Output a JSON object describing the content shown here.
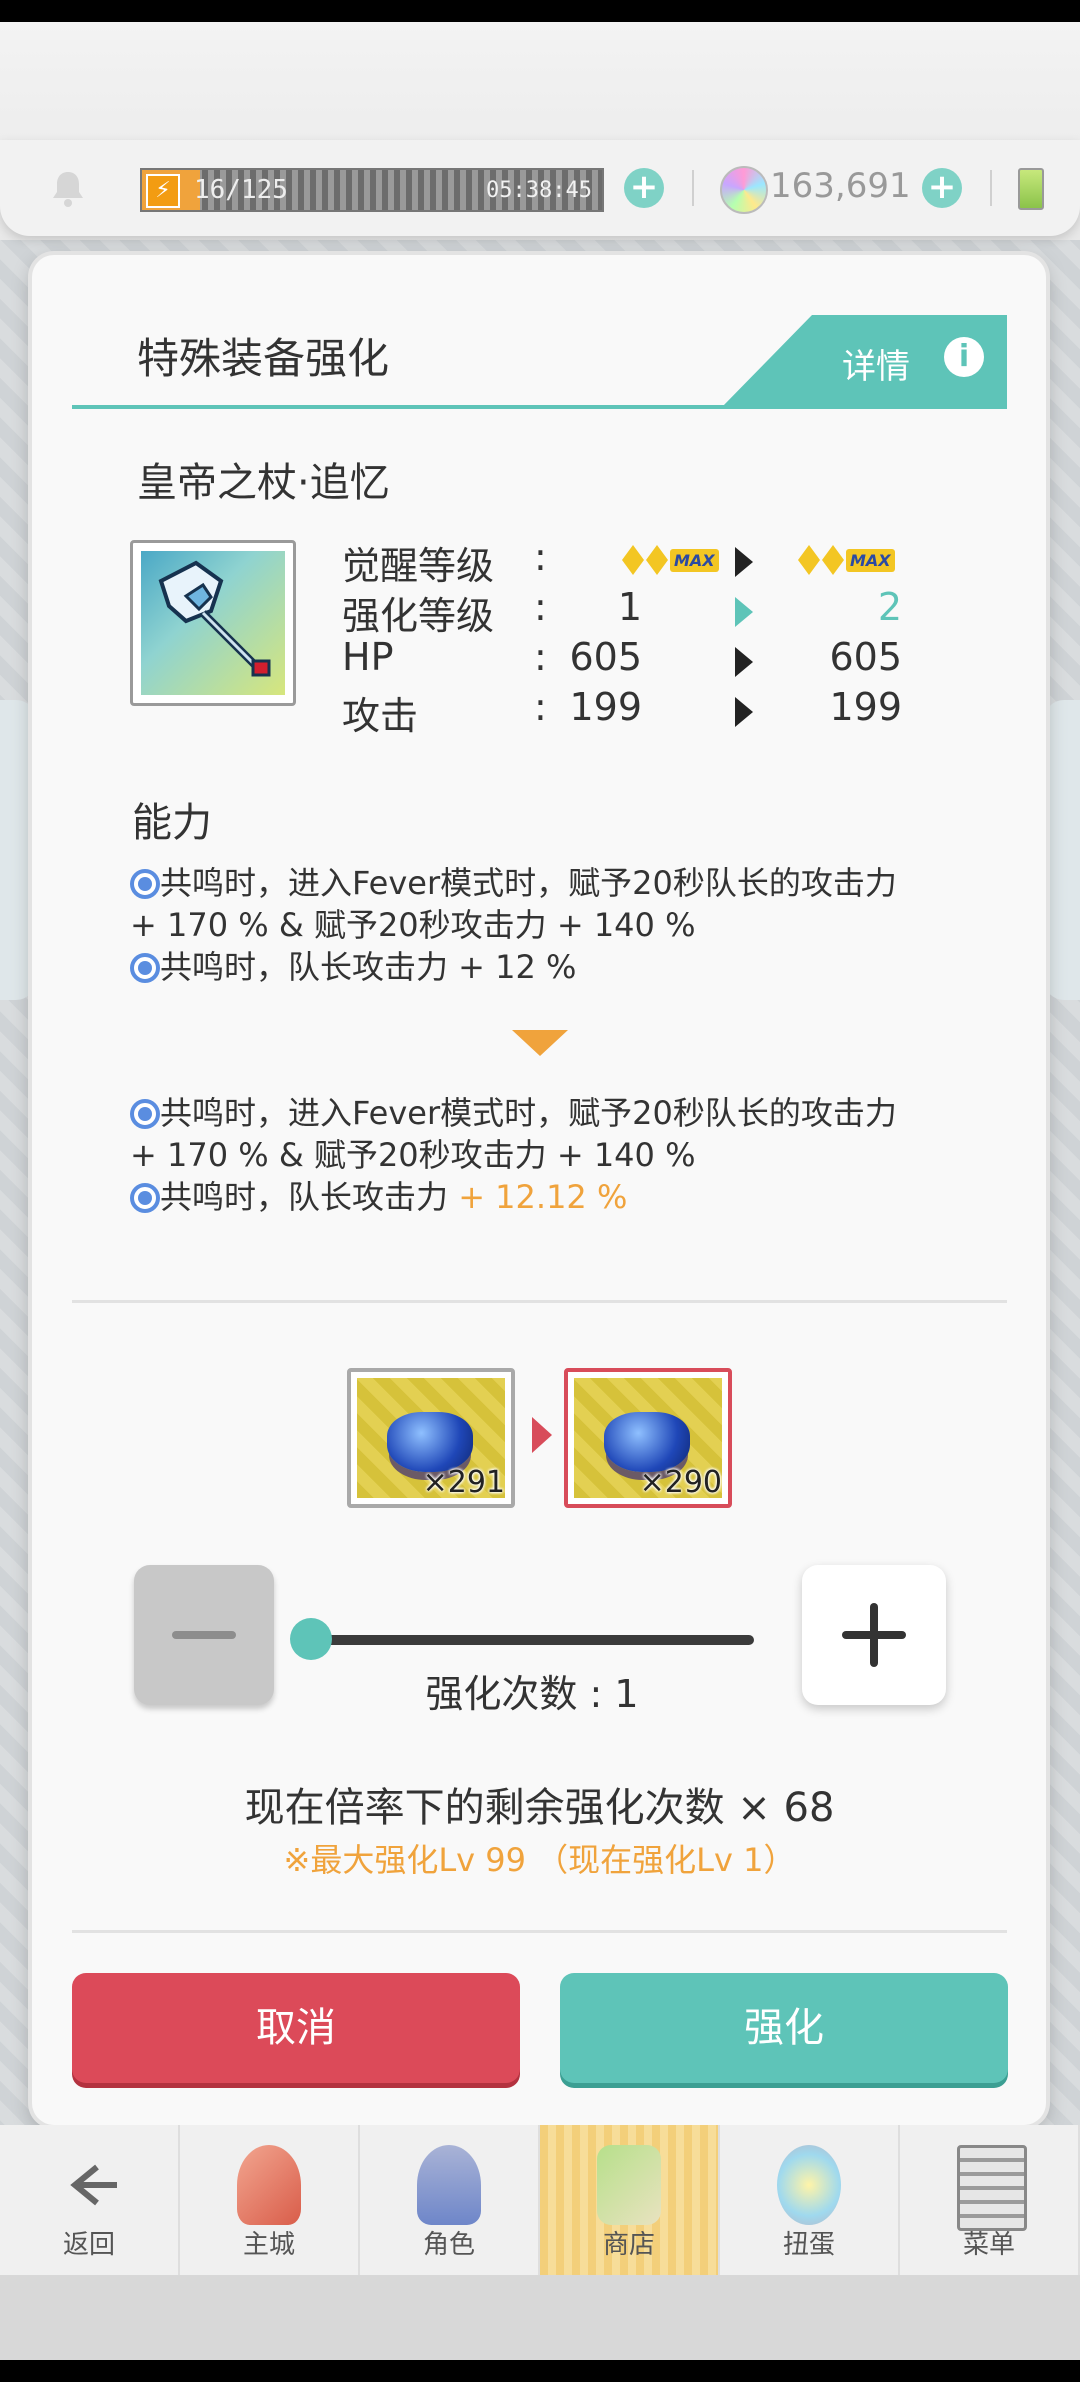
{
  "topbar": {
    "stamina": "16/125",
    "stamina_timer": "05:38:45",
    "gems": "163,691"
  },
  "dialog": {
    "title": "特殊装备强化",
    "detail_label": "详情",
    "item_name": "皇帝之杖·追忆",
    "stats": [
      {
        "label": "觉醒等级",
        "colon": ":",
        "from": "MAX",
        "to": "MAX"
      },
      {
        "label": "强化等级",
        "colon": ":",
        "from": "1",
        "to": "2"
      },
      {
        "label": "HP",
        "colon": ":",
        "from": "605",
        "to": "605"
      },
      {
        "label": "攻击",
        "colon": ":",
        "from": "199",
        "to": "199"
      }
    ],
    "ability_title": "能力",
    "abilities_before": {
      "line1": "共鸣时，进入Fever模式时，赋予20秒队长的攻击力",
      "line1b": "+ 170 % & 赋予20秒攻击力 + 140 %",
      "line2": "共鸣时，队长攻击力 + 12 %"
    },
    "abilities_after": {
      "line1": "共鸣时，进入Fever模式时，赋予20秒队长的攻击力",
      "line1b": "+ 170 % & 赋予20秒攻击力 + 140 %",
      "line2_prefix": "共鸣时，队长攻击力 ",
      "line2_value": "+ 12.12 %"
    },
    "materials": {
      "from_count": "×291",
      "to_count": "×290"
    },
    "slider": {
      "label": "强化次数 : 1",
      "fraction": 0.0
    },
    "remaining": "现在倍率下的剩余强化次数 × 68",
    "max_note": "※最大强化Lv 99 （现在强化Lv 1）",
    "cancel_label": "取消",
    "confirm_label": "强化"
  },
  "nav": [
    {
      "label": "返回",
      "icon": "back-arrow-icon"
    },
    {
      "label": "主城",
      "icon": "castle-icon"
    },
    {
      "label": "角色",
      "icon": "character-icon"
    },
    {
      "label": "商店",
      "icon": "shop-icon"
    },
    {
      "label": "扭蛋",
      "icon": "gacha-icon"
    },
    {
      "label": "菜单",
      "icon": "menu-icon"
    }
  ],
  "colors": {
    "teal": "#5ec4b8",
    "red": "#dc4a59",
    "orange": "#f0a33c"
  }
}
